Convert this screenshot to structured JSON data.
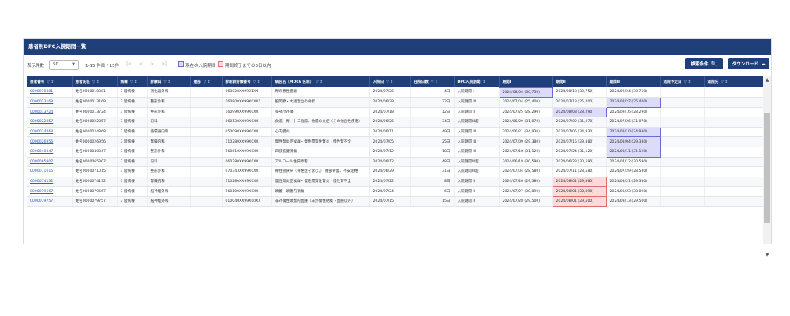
{
  "title": "患者別DPC入院期間一覧",
  "toolbar": {
    "page_size_label": "表示件数",
    "page_size_value": "50",
    "count_text": "1-15 件目 / 15件",
    "pager": [
      "|<",
      "<",
      ">",
      ">|"
    ],
    "legend_current": "現在の入院期間",
    "legend_ending": "期間終了までの3日以内",
    "search_button": "検索条件",
    "download_button": "ダウンロード"
  },
  "columns": [
    "患者番号",
    "患者氏名",
    "病棟",
    "診療科",
    "患部",
    "診断群分類番号",
    "病名名（MDC6 名称）",
    "入院日",
    "在院日数",
    "DPC入院期間",
    "期間Ⅰ",
    "期間Ⅱ",
    "期間Ⅲ",
    "退院予定日",
    "退院先"
  ],
  "rows": [
    {
      "id": "0000010381",
      "name": "姓名0000010381",
      "ward": "3 階病棟",
      "dept": "消化器外科",
      "part": "",
      "dpc": "060020XX9901XX",
      "disease": "胃の悪性腫瘍",
      "admit": "2024/07/26",
      "days": "4日",
      "period": "入院期間 I",
      "p1": "2024/08/04 (30,750)",
      "p2": "2024/08/13 (30,750)",
      "p3": "2024/09/24 (30,750)",
      "hl": "p1"
    },
    {
      "id": "0000013168",
      "name": "姓名0000013168",
      "ward": "3 階病棟",
      "dept": "整形外科",
      "part": "",
      "dpc": "160800XX99X0XX1",
      "disease": "股関節・大腿近位の骨折",
      "admit": "2024/06/28",
      "days": "32日",
      "period": "入院期間 III",
      "p1": "2024/07/04 (25,400)",
      "p2": "2024/07/13 (25,400)",
      "p3": "2024/08/27 (25,400)",
      "hl": "p3"
    },
    {
      "id": "0000013724",
      "name": "姓名0000013724",
      "ward": "3 階病棟",
      "dept": "整形外科",
      "part": "",
      "dpc": "160990XX99X0XX",
      "disease": "多部位外傷",
      "admit": "2024/07/18",
      "days": "12日",
      "period": "入院期間 II",
      "p1": "2024/07/25 (28,290)",
      "p2": "2024/08/03 (28,290)",
      "p3": "2024/09/16 (28,290)",
      "hl": "p2"
    },
    {
      "id": "0000022857",
      "name": "姓名0000022857",
      "ward": "3 階病棟",
      "dept": "内科",
      "part": "",
      "dpc": "060130XX99X0XX",
      "disease": "食道、胃、十二指腸、他腸の炎症（その他良性疾患）",
      "admit": "2024/06/26",
      "days": "34日",
      "period": "入院期間III超",
      "p1": "2024/06/29 (31,070)",
      "p2": "2024/07/02 (31,070)",
      "p3": "2024/07/26 (31,070)",
      "hl": ""
    },
    {
      "id": "0000024868",
      "name": "姓名0000024868",
      "ward": "3 階病棟",
      "dept": "循環器内科",
      "part": "",
      "dpc": "050090XX99X0XX",
      "disease": "心内膜炎",
      "admit": "2024/06/11",
      "days": "49日",
      "period": "入院期間 III",
      "p1": "2024/06/21 (34,930)",
      "p2": "2024/07/05 (34,930)",
      "p3": "2024/08/10 (34,930)",
      "hl": "p3"
    },
    {
      "id": "0000026956",
      "name": "姓名0000026956",
      "ward": "3 階病棟",
      "dept": "腎臓内科",
      "part": "",
      "dpc": "110280XX99X0XX",
      "disease": "慢性腎炎症候群・慢性間質性腎炎・慢性腎不全",
      "admit": "2024/07/05",
      "days": "25日",
      "period": "入院期間 III",
      "p1": "2024/07/09 (29,380)",
      "p2": "2024/07/15 (29,380)",
      "p3": "2024/08/04 (29,380)",
      "hl": "p3"
    },
    {
      "id": "0000040847",
      "name": "姓名0000040847",
      "ward": "3 階病棟",
      "dept": "整形外科",
      "part": "",
      "dpc": "160610XX99X0XX",
      "disease": "四肢筋腱損傷",
      "admit": "2024/07/12",
      "days": "18日",
      "period": "入院期間 III",
      "p1": "2024/07/18 (31,120)",
      "p2": "2024/07/24 (31,120)",
      "p3": "2024/08/11 (31,120)",
      "hl": "p3"
    },
    {
      "id": "0000065907",
      "name": "姓名0000065907",
      "ward": "3 階病棟",
      "dept": "内科",
      "part": "",
      "dpc": "060280XX99X0XX",
      "disease": "アルコール性肝障害",
      "admit": "2024/06/12",
      "days": "48日",
      "period": "入院期間III超",
      "p1": "2024/06/18 (30,590)",
      "p2": "2024/06/23 (30,590)",
      "p3": "2024/07/12 (30,590)",
      "hl": ""
    },
    {
      "id": "0000071015",
      "name": "姓名0000071015",
      "ward": "3 階病棟",
      "dept": "整形外科",
      "part": "",
      "dpc": "070343XX99X0XX",
      "disease": "脊柱管狭窄（脊椎症を含む。） 腰部骨盤、不安定椎",
      "admit": "2024/06/29",
      "days": "31日",
      "period": "入院期間III超",
      "p1": "2024/07/04 (28,580)",
      "p2": "2024/07/11 (28,580)",
      "p3": "2024/07/29 (28,580)",
      "hl": ""
    },
    {
      "id": "0000074132",
      "name": "姓名0000074132",
      "ward": "3 階病棟",
      "dept": "腎臓内科",
      "part": "",
      "dpc": "110280XX99X0XX",
      "disease": "慢性腎炎症候群・慢性間質性腎炎・慢性腎不全",
      "admit": "2024/07/22",
      "days": "8日",
      "period": "入院期間 II",
      "p1": "2024/07/26 (29,380)",
      "p2": "2024/08/01 (29,380)",
      "p3": "2024/08/21 (29,380)",
      "hl": "p2end"
    },
    {
      "id": "0000079667",
      "name": "姓名0000079667",
      "ward": "3 階病棟",
      "dept": "脳神経外科",
      "part": "",
      "dpc": "160100XX99X0XX",
      "disease": "頭蓋・頭蓋内損傷",
      "admit": "2024/07/24",
      "days": "6日",
      "period": "入院期間 II",
      "p1": "2024/07/27 (38,890)",
      "p2": "2024/08/01 (38,890)",
      "p3": "2024/08/23 (38,890)",
      "hl": "p2end"
    },
    {
      "id": "0000079757",
      "name": "姓名0000079757",
      "ward": "3 階病棟",
      "dept": "脳神経外科",
      "part": "",
      "dpc": "010040XX99X00XX",
      "disease": "非外傷性頭蓋内血腫（非外傷性硬膜下血腫以外）",
      "admit": "2024/07/15",
      "days": "15日",
      "period": "入院期間 II",
      "p1": "2024/07/28 (29,500)",
      "p2": "2024/08/01 (29,500)",
      "p3": "2024/09/13 (29,500)",
      "hl": "p2end"
    }
  ],
  "colors": {
    "header": "#1f3f7a",
    "current": "#dcdcfa",
    "ending": "#fbdada",
    "link": "#2a62c9"
  }
}
